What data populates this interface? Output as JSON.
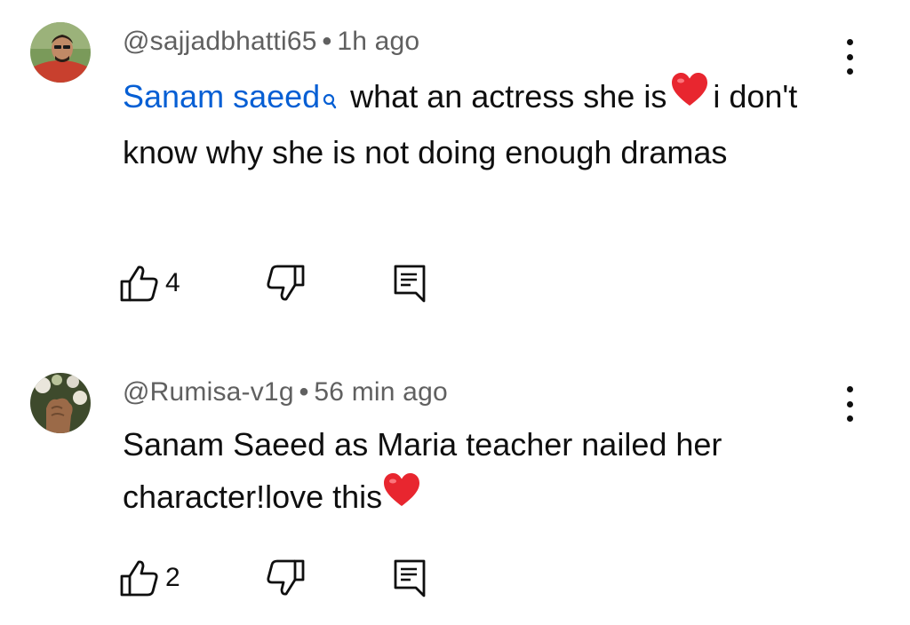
{
  "comments": [
    {
      "handle": "@sajjadbhatti65",
      "separator": "•",
      "time": "1h ago",
      "mention": "Sanam saeed",
      "text_line": "what an actress she is",
      "text_tail": "i don't know why she is not doing enough dramas",
      "likes": "4",
      "avatar_icon": "user-avatar-man-red-shirt",
      "heart_icon": "red-heart-emoji",
      "mention_icon": "search-icon"
    },
    {
      "handle": "@Rumisa-v1g",
      "separator": "•",
      "time": "56 min ago",
      "text": "Sanam Saeed as Maria teacher nailed her character!love this",
      "likes": "2",
      "avatar_icon": "user-avatar-hand-flowers",
      "heart_icon": "red-heart-emoji"
    }
  ],
  "icons": {
    "like": "thumb-up-icon",
    "dislike": "thumb-down-icon",
    "reply": "reply-comment-icon",
    "more": "more-vertical-icon"
  },
  "colors": {
    "mention": "#065fd4",
    "meta": "#606060",
    "text": "#0f0f0f",
    "heart": "#e8262f"
  }
}
